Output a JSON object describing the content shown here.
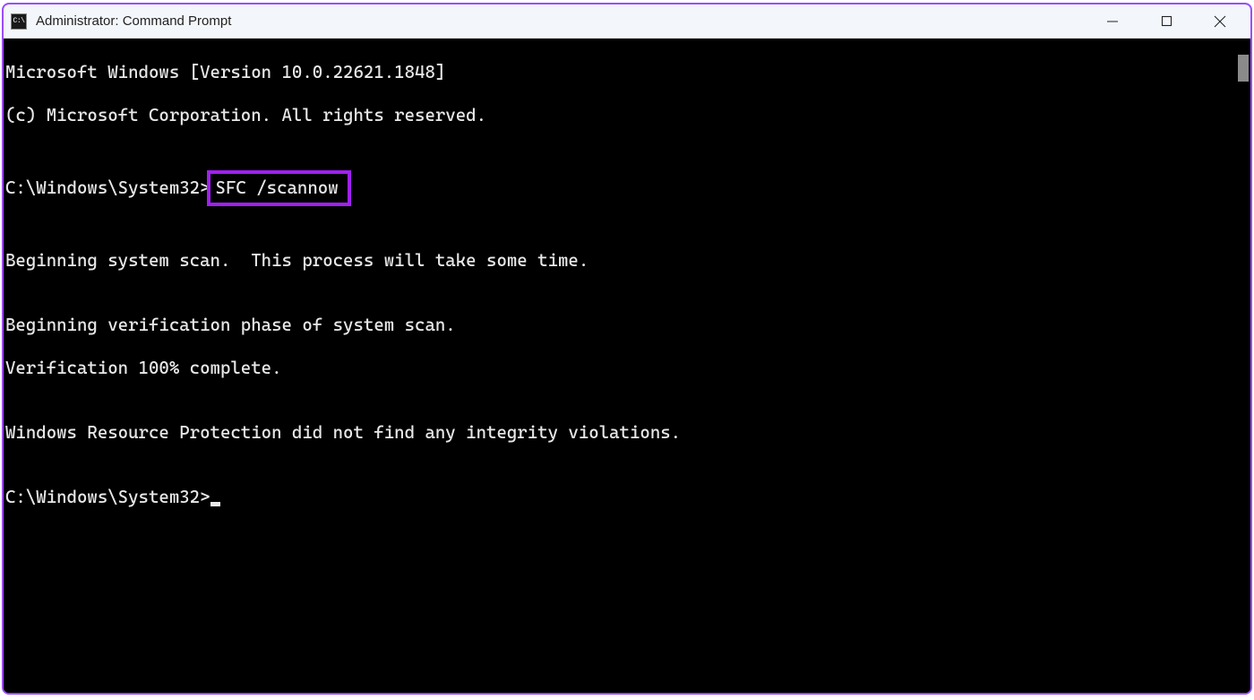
{
  "titlebar": {
    "icon_label": "C:\\",
    "title": "Administrator: Command Prompt"
  },
  "terminal": {
    "line_version": "Microsoft Windows [Version 10.0.22621.1848]",
    "line_copyright": "(c) Microsoft Corporation. All rights reserved.",
    "prompt1_path": "C:\\Windows\\System32>",
    "prompt1_command": "SFC /scannow",
    "line_begin_scan": "Beginning system scan.  This process will take some time.",
    "line_begin_verify": "Beginning verification phase of system scan.",
    "line_verify_complete": "Verification 100% complete.",
    "line_result": "Windows Resource Protection did not find any integrity violations.",
    "prompt2_path": "C:\\Windows\\System32>"
  },
  "annotation": {
    "highlight_color": "#a020f0"
  }
}
